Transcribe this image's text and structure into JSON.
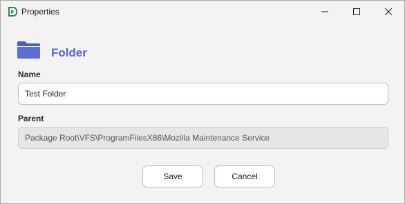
{
  "window": {
    "title": "Properties",
    "icons": {
      "app": "app-logo-icon",
      "minimize": "minimize-icon",
      "maximize": "maximize-icon",
      "close": "close-icon"
    }
  },
  "header": {
    "title": "Folder",
    "icon": "folder-icon",
    "accent_color": "#5566c6"
  },
  "fields": {
    "name": {
      "label": "Name",
      "value": "Test Folder"
    },
    "parent": {
      "label": "Parent",
      "value": "Package Root\\VFS\\ProgramFilesX86\\Mozilla Maintenance Service",
      "readonly": true
    }
  },
  "buttons": {
    "save_label": "Save",
    "cancel_label": "Cancel"
  }
}
